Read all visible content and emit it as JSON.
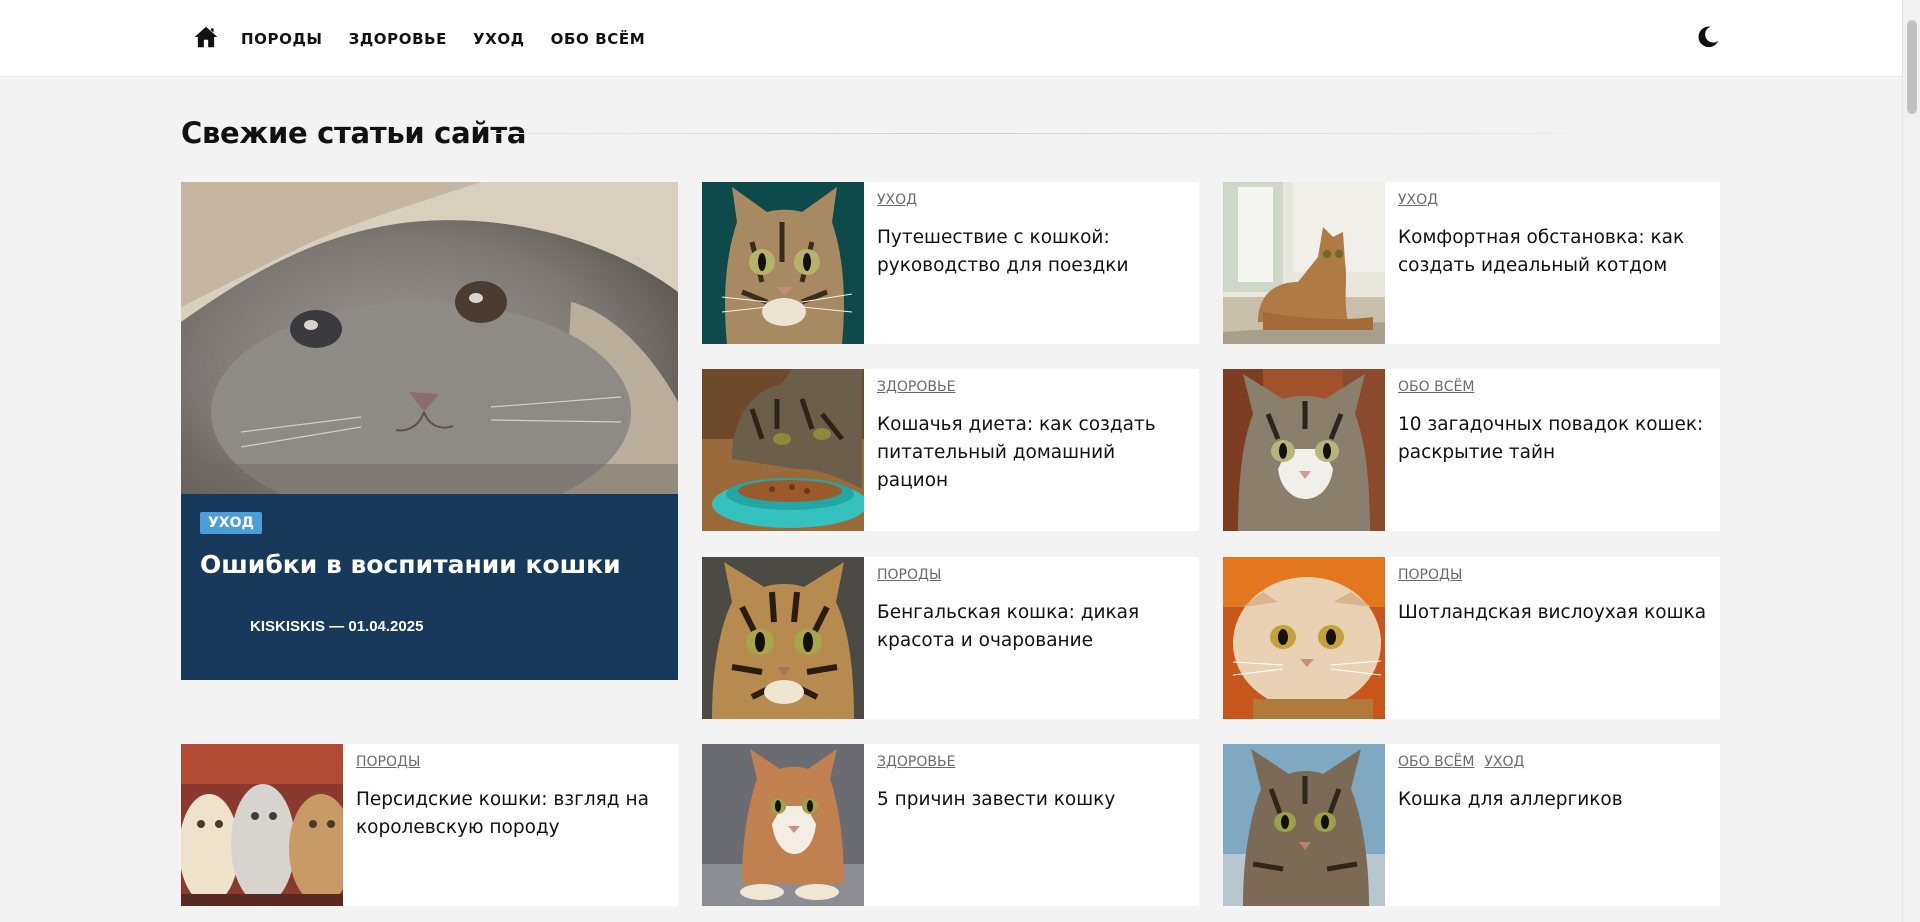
{
  "nav": {
    "home_icon": "home-icon",
    "items": [
      {
        "label": "ПОРОДЫ"
      },
      {
        "label": "ЗДОРОВЬЕ"
      },
      {
        "label": "УХОД"
      },
      {
        "label": "ОБО ВСЁМ"
      }
    ],
    "theme_icon": "moon-icon"
  },
  "section": {
    "title": "Свежие статьи сайта"
  },
  "featured": {
    "category": "УХОД",
    "title": "Ошибки в воспитании кошки",
    "meta": "KISKISKIS — 01.04.2025",
    "image": "grey-cat-under-blanket"
  },
  "cards": [
    {
      "categories": [
        "УХОД"
      ],
      "title": "Путешествие с кошкой: руководство для поездки",
      "image": "tabby-cat-portrait"
    },
    {
      "categories": [
        "УХОД"
      ],
      "title": "Комфортная обстановка: как создать идеальный котдом",
      "image": "cat-lying-by-window"
    },
    {
      "categories": [
        "ЗДОРОВЬЕ"
      ],
      "title": "Кошачья диета: как создать питательный домашний рацион",
      "image": "cat-eating-from-bowl"
    },
    {
      "categories": [
        "ОБО ВСЁМ"
      ],
      "title": "10 загадочных повадок кошек: раскрытие тайн",
      "image": "tabby-white-cat"
    },
    {
      "categories": [
        "ПОРОДЫ"
      ],
      "title": "Бенгальская кошка: дикая красота и очарование",
      "image": "bengal-cat"
    },
    {
      "categories": [
        "ПОРОДЫ"
      ],
      "title": "Шотландская вислоухая кошка",
      "image": "scottish-fold-cat"
    },
    {
      "categories": [
        "ПОРОДЫ"
      ],
      "title": "Персидские кошки: взгляд на королевскую породу",
      "image": "persian-cats"
    },
    {
      "categories": [
        "ЗДОРОВЬЕ"
      ],
      "title": "5 причин завести кошку",
      "image": "lying-kitten"
    },
    {
      "categories": [
        "ОБО ВСЁМ",
        "УХОД"
      ],
      "title": "Кошка для аллергиков",
      "image": "tabby-cat-lying"
    }
  ],
  "colors": {
    "featured_bg": "#173a5c",
    "badge": "#4b9fd6",
    "page_bg": "#f3f3f3"
  }
}
